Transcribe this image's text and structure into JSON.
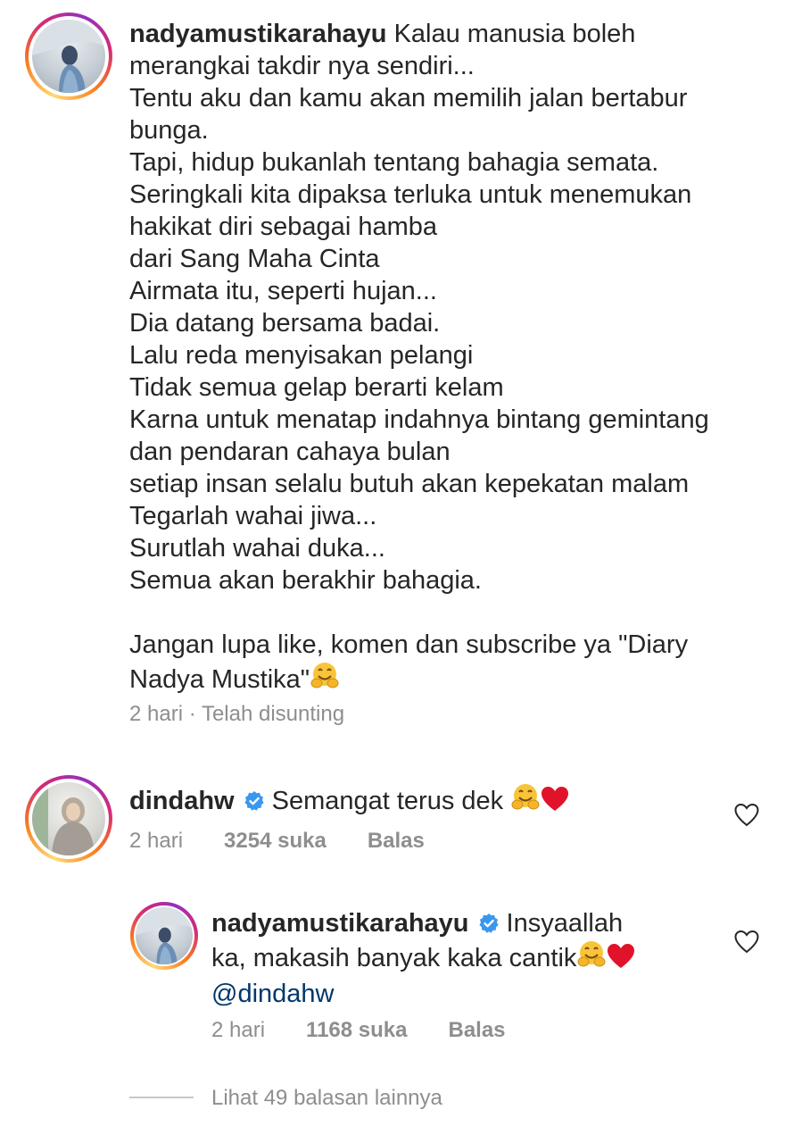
{
  "post": {
    "username": "nadyamustikarahayu",
    "caption": " Kalau manusia boleh\nmerangkai takdir nya sendiri...\nTentu aku dan kamu akan memilih jalan bertabur\nbunga.\nTapi, hidup bukanlah tentang bahagia semata.\nSeringkali kita dipaksa terluka untuk menemukan\nhakikat diri sebagai hamba\ndari Sang Maha Cinta\nAirmata itu, seperti hujan...\nDia datang bersama badai.\nLalu reda menyisakan pelangi\nTidak semua gelap berarti kelam\nKarna untuk menatap indahnya bintang gemintang\ndan pendaran cahaya bulan\nsetiap insan selalu butuh akan kepekatan malam\nTegarlah wahai jiwa...\nSurutlah wahai duka...\nSemua akan berakhir bahagia.\n\nJangan lupa like, komen dan subscribe ya \"Diary\nNadya Mustika\"",
    "time": "2 hari",
    "separator": " · ",
    "edited": "Telah disunting"
  },
  "comment": {
    "username": "dindahw",
    "text": "Semangat terus dek ",
    "time": "2 hari",
    "likes": "3254 suka",
    "reply_label": "Balas"
  },
  "reply": {
    "username": "nadyamustikarahayu",
    "text_first": "Insyaallah",
    "text_second": "ka, makasih banyak kaka cantik",
    "mention": "@dindahw",
    "time": "2 hari",
    "likes": "1168 suka",
    "reply_label": "Balas"
  },
  "more_replies": "Lihat 49 balasan lainnya",
  "icons": {
    "verified": "verified-badge-icon",
    "like": "heart-outline-icon",
    "hug": "hugging-face-emoji",
    "red_heart": "red-heart-emoji"
  },
  "colors": {
    "text": "#262626",
    "muted": "#8e8e8e",
    "verified": "#3897f0",
    "emoji_heart": "#e0132b"
  }
}
